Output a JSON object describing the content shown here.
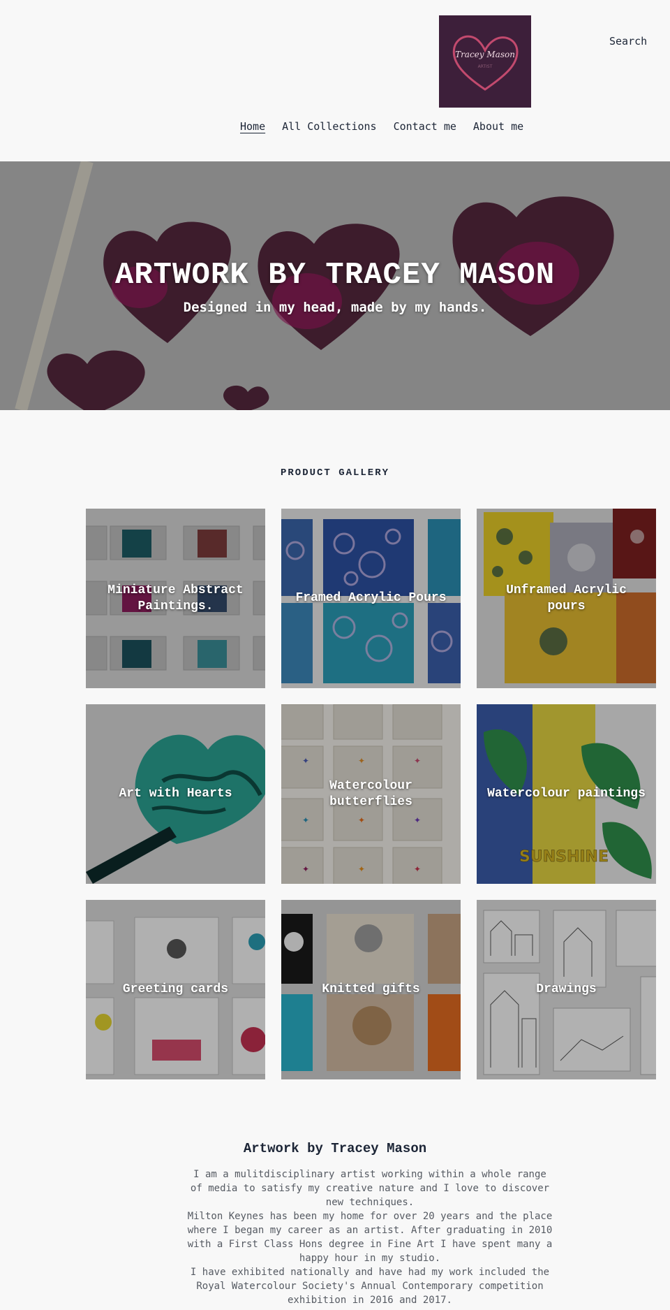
{
  "header": {
    "logo": {
      "title": "Tracey Mason",
      "subtitle": "ARTIST",
      "bg": "#3d1f3a",
      "accent": "#c24a6e"
    },
    "search_label": "Search"
  },
  "nav": {
    "items": [
      {
        "label": "Home",
        "active": true
      },
      {
        "label": "All Collections"
      },
      {
        "label": "Contact me"
      },
      {
        "label": "About me"
      }
    ]
  },
  "hero": {
    "title": "ARTWORK BY TRACEY MASON",
    "subtitle": "Designed in my head, made by my hands."
  },
  "gallery": {
    "title": "PRODUCT GALLERY",
    "tiles": [
      {
        "label": "Miniature Abstract Paintings."
      },
      {
        "label": "Framed Acrylic Pours"
      },
      {
        "label": "Unframed Acrylic pours"
      },
      {
        "label": "Art with Hearts"
      },
      {
        "label": "Watercolour butterflies"
      },
      {
        "label": "Watercolour paintings"
      },
      {
        "label": "Greeting cards"
      },
      {
        "label": "Knitted gifts"
      },
      {
        "label": "Drawings"
      }
    ]
  },
  "about": {
    "title": "Artwork by Tracey Mason",
    "paragraphs": [
      "I am a mulitdisciplinary artist working within a whole range of media to satisfy my creative nature and I love to discover new techniques.",
      "Milton Keynes has been my home for over 20 years and the place where I began my career as an artist. After graduating in 2010 with a First Class Hons degree in Fine Art I have spent many a happy hour in my studio.",
      "I have exhibited nationally and have had my work included the Royal Watercolour Society's Annual Contemporary competition exhibition in 2016 and 2017."
    ]
  },
  "colors": {
    "text": "#1c2536",
    "body_text": "#555a62",
    "page_bg": "#f8f8f8"
  }
}
